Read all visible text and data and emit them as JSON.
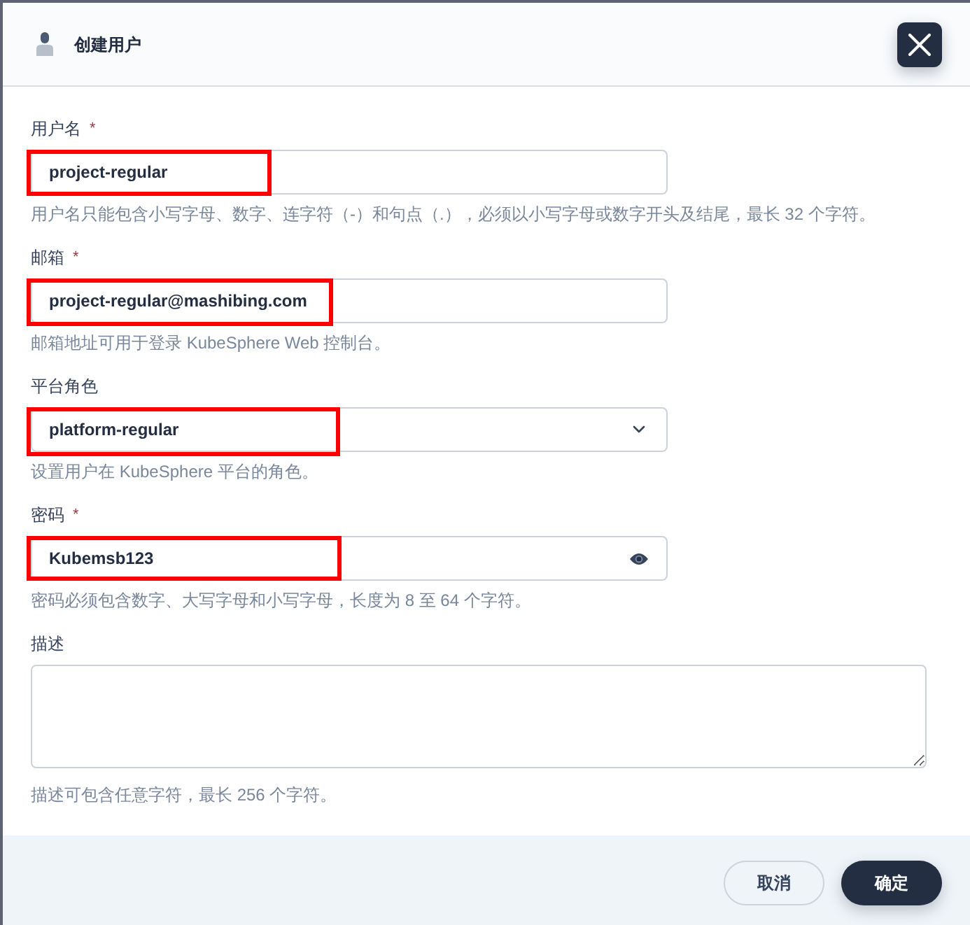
{
  "dialog": {
    "title": "创建用户"
  },
  "fields": [
    {
      "kind": "text",
      "label": "用户名",
      "mark": "*",
      "value": "project-regular",
      "hint": "用户名只能包含小写字母、数字、连字符（-）和句点（.），必须以小写字母或数字开头及结尾，最长 32 个字符。",
      "highlighted": true
    },
    {
      "kind": "text",
      "label": "邮箱",
      "mark": "*",
      "value": "project-regular@mashibing.com",
      "hint": "邮箱地址可用于登录 KubeSphere Web 控制台。",
      "highlighted": true
    },
    {
      "kind": "select",
      "label": "平台角色",
      "value": "platform-regular",
      "hint": "设置用户在 KubeSphere 平台的角色。",
      "highlighted": true
    },
    {
      "kind": "password",
      "label": "密码",
      "mark": "*",
      "value": "Kubemsb123",
      "hint": "密码必须包含数字、大写字母和小写字母，长度为 8 至 64 个字符。",
      "highlighted": true
    },
    {
      "kind": "textarea",
      "label": "描述",
      "hint": "描述可包含任意字符，最长 256 个字符。"
    }
  ],
  "buttons": [
    {
      "kind": "secondary",
      "label": "取消"
    },
    {
      "kind": "primary",
      "label": "确定"
    }
  ]
}
